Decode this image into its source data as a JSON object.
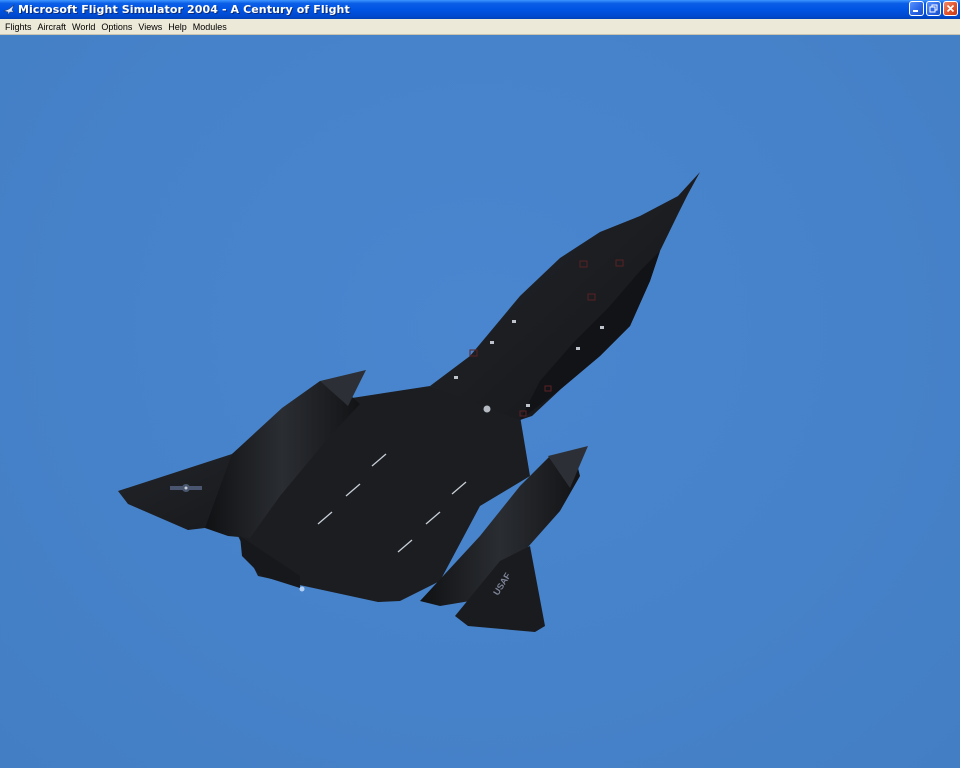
{
  "window": {
    "title": "Microsoft Flight Simulator 2004 - A Century of Flight",
    "buttons": {
      "minimize": "minimize-icon",
      "restore": "restore-icon",
      "close": "close-icon"
    }
  },
  "menubar": {
    "items": [
      "Flights",
      "Aircraft",
      "World",
      "Options",
      "Views",
      "Help",
      "Modules"
    ]
  },
  "scene": {
    "sky_color": "#4682c8",
    "aircraft_color": "#1a1c20",
    "aircraft_marking": "USAF"
  }
}
